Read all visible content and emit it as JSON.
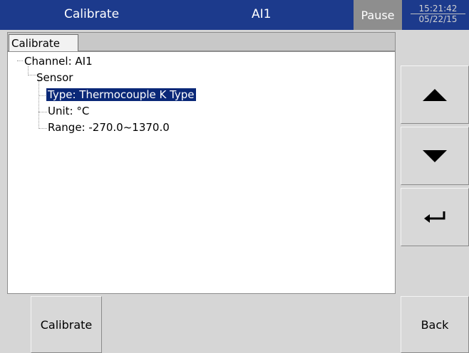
{
  "header": {
    "title": "Calibrate",
    "channel": "AI1",
    "status": "Pause",
    "time": "15:21:42",
    "date": "05/22/15",
    "colors": {
      "titlebar": "#1c3a8c",
      "pause_bg": "#8e8e8e",
      "selection": "#0a2878"
    }
  },
  "tabs": [
    {
      "label": "Calibrate"
    }
  ],
  "tree": {
    "channel": "Channel: AI1",
    "sensor": "Sensor",
    "type": "Type: Thermocouple K Type",
    "unit": "Unit: °C",
    "range": "Range: -270.0~1370.0",
    "selected": "type"
  },
  "side_buttons": {
    "up_icon": "triangle-up-icon",
    "down_icon": "triangle-down-icon",
    "enter_icon": "enter-return-icon"
  },
  "footer": {
    "calibrate_label": "Calibrate",
    "back_label": "Back"
  }
}
